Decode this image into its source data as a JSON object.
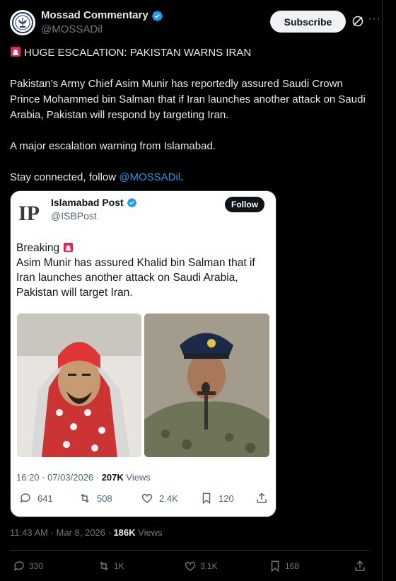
{
  "author": {
    "name": "Mossad Commentary",
    "handle": "@MOSSADil",
    "subscribe_label": "Subscribe"
  },
  "post": {
    "headline": "HUGE ESCALATION: PAKISTAN WARNS IRAN",
    "paragraph1": "Pakistan’s Army Chief Asim Munir has reportedly assured Saudi Crown Prince Mohammed bin Salman that if Iran launches another attack on Saudi Arabia, Pakistan will respond by targeting Iran.",
    "paragraph2": "A major escalation warning from Islamabad.",
    "paragraph3_prefix": "Stay connected, follow ",
    "paragraph3_mention": "@MOSSADil",
    "paragraph3_suffix": "."
  },
  "quoted": {
    "name": "Islamabad Post",
    "handle": "@ISBPost",
    "follow_label": "Follow",
    "breaking": "Breaking",
    "text": "Asim Munir has assured Khalid bin Salman that if Iran launches another attack on Saudi Arabia, Pakistan will target Iran.",
    "time": "16:20 · 07/03/2026 · ",
    "views_count": "207K",
    "views_label": " Views",
    "replies": "641",
    "reposts": "508",
    "likes": "2.4K",
    "bookmarks": "120"
  },
  "meta": {
    "time": "11:43 AM · Mar 8, 2026 · ",
    "views_count": "186K",
    "views_label": " Views"
  },
  "actions": {
    "replies": "330",
    "reposts": "1K",
    "likes": "3.1K",
    "bookmarks": "168"
  },
  "colors": {
    "background": "#000000",
    "text": "#e7e9ea",
    "muted": "#71767b",
    "link": "#1d9bf0",
    "verified": "#1d9bf0"
  }
}
